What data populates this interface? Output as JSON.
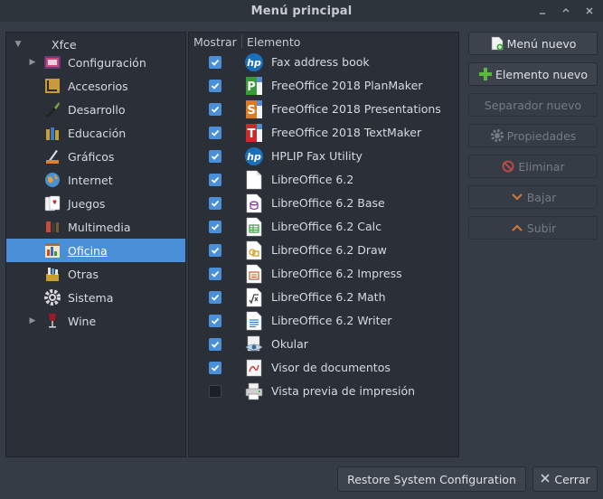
{
  "window": {
    "title": "Menú principal"
  },
  "tree": {
    "root": "Xfce",
    "items": [
      {
        "label": "Configuración",
        "icon": "configuration-icon",
        "expandable": true
      },
      {
        "label": "Accesorios",
        "icon": "accessories-icon",
        "expandable": false
      },
      {
        "label": "Desarrollo",
        "icon": "development-icon",
        "expandable": false
      },
      {
        "label": "Educación",
        "icon": "education-icon",
        "expandable": false
      },
      {
        "label": "Gráficos",
        "icon": "graphics-icon",
        "expandable": false
      },
      {
        "label": "Internet",
        "icon": "internet-globe-icon",
        "expandable": false
      },
      {
        "label": "Juegos",
        "icon": "games-cards-icon",
        "expandable": false
      },
      {
        "label": "Multimedia",
        "icon": "multimedia-icon",
        "expandable": false
      },
      {
        "label": "Oficina",
        "icon": "office-icon",
        "expandable": false,
        "selected": true
      },
      {
        "label": "Otras",
        "icon": "other-icon",
        "expandable": false
      },
      {
        "label": "Sistema",
        "icon": "system-gear-icon",
        "expandable": false
      },
      {
        "label": "Wine",
        "icon": "wine-glass-icon",
        "expandable": true
      }
    ]
  },
  "list": {
    "col_show": "Mostrar",
    "col_item": "Elemento",
    "rows": [
      {
        "label": "Fax address book",
        "shown": true,
        "icon": "hp-icon"
      },
      {
        "label": "FreeOffice 2018 PlanMaker",
        "shown": true,
        "icon": "planmaker-icon"
      },
      {
        "label": "FreeOffice 2018 Presentations",
        "shown": true,
        "icon": "presentations-icon"
      },
      {
        "label": "FreeOffice 2018 TextMaker",
        "shown": true,
        "icon": "textmaker-icon"
      },
      {
        "label": "HPLIP Fax Utility",
        "shown": true,
        "icon": "hp-icon"
      },
      {
        "label": "LibreOffice 6.2",
        "shown": true,
        "icon": "libreoffice-icon"
      },
      {
        "label": "LibreOffice 6.2 Base",
        "shown": true,
        "icon": "libreoffice-base-icon"
      },
      {
        "label": "LibreOffice 6.2 Calc",
        "shown": true,
        "icon": "libreoffice-calc-icon"
      },
      {
        "label": "LibreOffice 6.2 Draw",
        "shown": true,
        "icon": "libreoffice-draw-icon"
      },
      {
        "label": "LibreOffice 6.2 Impress",
        "shown": true,
        "icon": "libreoffice-impress-icon"
      },
      {
        "label": "LibreOffice 6.2 Math",
        "shown": true,
        "icon": "libreoffice-math-icon"
      },
      {
        "label": "LibreOffice 6.2 Writer",
        "shown": true,
        "icon": "libreoffice-writer-icon"
      },
      {
        "label": "Okular",
        "shown": true,
        "icon": "okular-icon"
      },
      {
        "label": "Visor de documentos",
        "shown": true,
        "icon": "document-viewer-icon"
      },
      {
        "label": "Vista previa de impresión",
        "shown": false,
        "icon": "print-preview-icon"
      }
    ]
  },
  "buttons": {
    "new_menu": "Menú nuevo",
    "new_item": "Elemento nuevo",
    "new_separator": "Separador nuevo",
    "properties": "Propiedades",
    "delete": "Eliminar",
    "down": "Bajar",
    "up": "Subir",
    "restore": "Restore System Configuration",
    "close": "Cerrar"
  },
  "colors": {
    "accent": "#4a90d9",
    "background": "#353c45",
    "panel": "#2b3038"
  }
}
